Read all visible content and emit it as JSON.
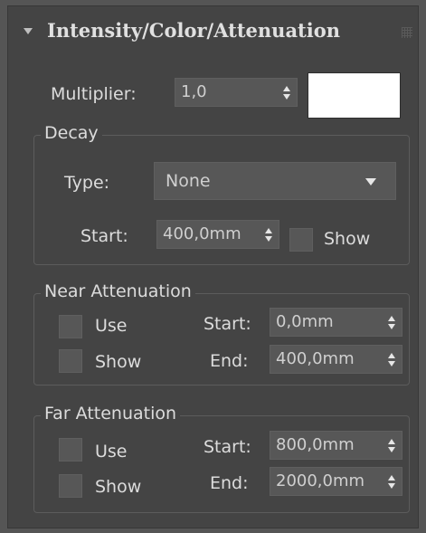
{
  "rollout": {
    "title": "Intensity/Color/Attenuation",
    "multiplier": {
      "label": "Multiplier:",
      "value": "1,0"
    },
    "color_swatch": "#ffffff",
    "decay": {
      "group_label": "Decay",
      "type_label": "Type:",
      "type_value": "None",
      "start_label": "Start:",
      "start_value": "400,0mm",
      "show_label": "Show"
    },
    "near_attenuation": {
      "group_label": "Near Attenuation",
      "use_label": "Use",
      "show_label": "Show",
      "start_label": "Start:",
      "start_value": "0,0mm",
      "end_label": "End:",
      "end_value": "400,0mm"
    },
    "far_attenuation": {
      "group_label": "Far Attenuation",
      "use_label": "Use",
      "show_label": "Show",
      "start_label": "Start:",
      "start_value": "800,0mm",
      "end_label": "End:",
      "end_value": "2000,0mm"
    }
  },
  "icons": {
    "collapse": "triangle-down",
    "grip": "grip-dots",
    "spinner": "up-down-arrows",
    "dropdown": "triangle-down"
  },
  "colors": {
    "panel": "#444444",
    "field": "#575757",
    "background": "#555555"
  }
}
